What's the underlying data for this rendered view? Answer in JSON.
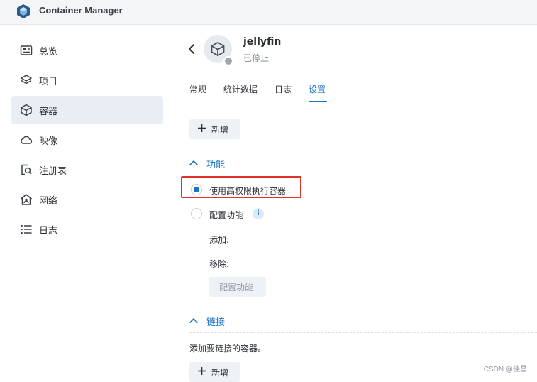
{
  "app": {
    "title": "Container Manager"
  },
  "sidebar": {
    "items": [
      {
        "label": "总览",
        "icon": "overview-icon"
      },
      {
        "label": "项目",
        "icon": "layers-icon"
      },
      {
        "label": "容器",
        "icon": "cube-icon",
        "active": true
      },
      {
        "label": "映像",
        "icon": "cloud-icon"
      },
      {
        "label": "注册表",
        "icon": "registry-search-icon"
      },
      {
        "label": "网络",
        "icon": "network-house-icon"
      },
      {
        "label": "日志",
        "icon": "list-icon"
      }
    ]
  },
  "container": {
    "name": "jellyfin",
    "status": "已停止"
  },
  "tabs": [
    {
      "label": "常规"
    },
    {
      "label": "统计数据"
    },
    {
      "label": "日志"
    },
    {
      "label": "设置",
      "active": true
    }
  ],
  "buttons": {
    "add_top": "新增",
    "add_bottom": "新增"
  },
  "sections": {
    "capabilities": {
      "title": "功能",
      "option_privileged": "使用高权限执行容器",
      "option_configure": "配置功能",
      "add_label": "添加:",
      "add_value": "-",
      "remove_label": "移除:",
      "remove_value": "-",
      "configure_button": "配置功能"
    },
    "links": {
      "title": "链接",
      "description": "添加要链接的容器。"
    }
  },
  "watermark": "CSDN @佳昌",
  "colors": {
    "accent": "#1b74c5",
    "highlight_box": "#e0302a",
    "active_nav_bg": "#e9eef5"
  }
}
